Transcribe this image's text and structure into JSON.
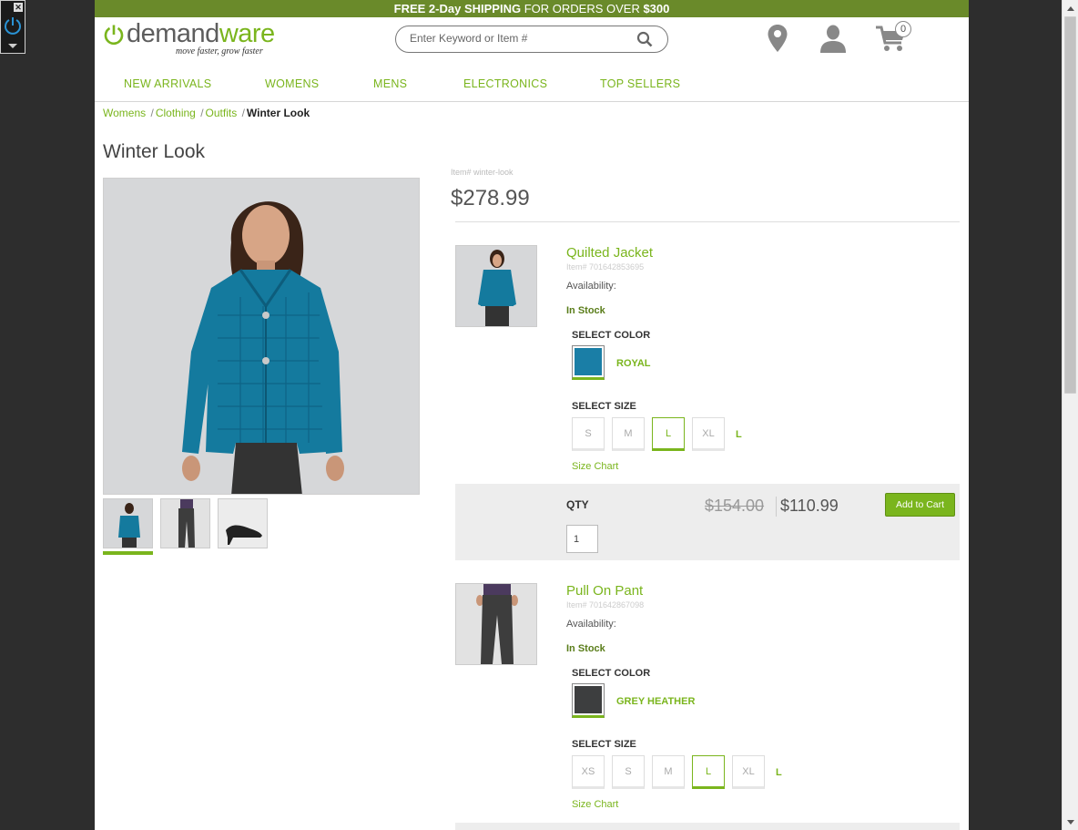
{
  "promo": {
    "free": "FREE 2-Day",
    "shipping": "SHIPPING",
    "for_orders": "FOR ORDERS OVER",
    "amount": "$300"
  },
  "logo": {
    "demand": "demand",
    "ware": "ware",
    "tagline": "move faster, grow faster"
  },
  "search": {
    "placeholder": "Enter Keyword or Item #"
  },
  "cart": {
    "count": "0"
  },
  "nav": [
    "NEW ARRIVALS",
    "WOMENS",
    "MENS",
    "ELECTRONICS",
    "TOP SELLERS"
  ],
  "breadcrumb": [
    "Womens",
    "Clothing",
    "Outfits",
    "Winter Look"
  ],
  "page_title": "Winter Look",
  "set": {
    "item_no": "Item# winter-look",
    "price": "$278.99"
  },
  "products": [
    {
      "name": "Quilted Jacket",
      "item_no": "Item# 701642853695",
      "availability_label": "Availability:",
      "stock": "In Stock",
      "color_label": "SELECT COLOR",
      "color_name": "ROYAL",
      "swatch_color": "#1a7ea6",
      "size_label": "SELECT SIZE",
      "sizes": [
        "S",
        "M",
        "L",
        "XL"
      ],
      "selected_size": "L",
      "size_chart": "Size Chart",
      "qty_label": "QTY",
      "qty": "1",
      "old_price": "$154.00",
      "price": "$110.99",
      "add_to_cart": "Add to Cart"
    },
    {
      "name": "Pull On Pant",
      "item_no": "Item# 701642867098",
      "availability_label": "Availability:",
      "stock": "In Stock",
      "color_label": "SELECT COLOR",
      "color_name": "GREY HEATHER",
      "swatch_color": "#3d3e3f",
      "size_label": "SELECT SIZE",
      "sizes": [
        "XS",
        "S",
        "M",
        "L",
        "XL"
      ],
      "selected_size": "L",
      "size_chart": "Size Chart"
    }
  ],
  "colors": {
    "brand_green": "#7ab51d",
    "promo_bar": "#6a8a2a",
    "stock_green": "#5a7d1a"
  }
}
